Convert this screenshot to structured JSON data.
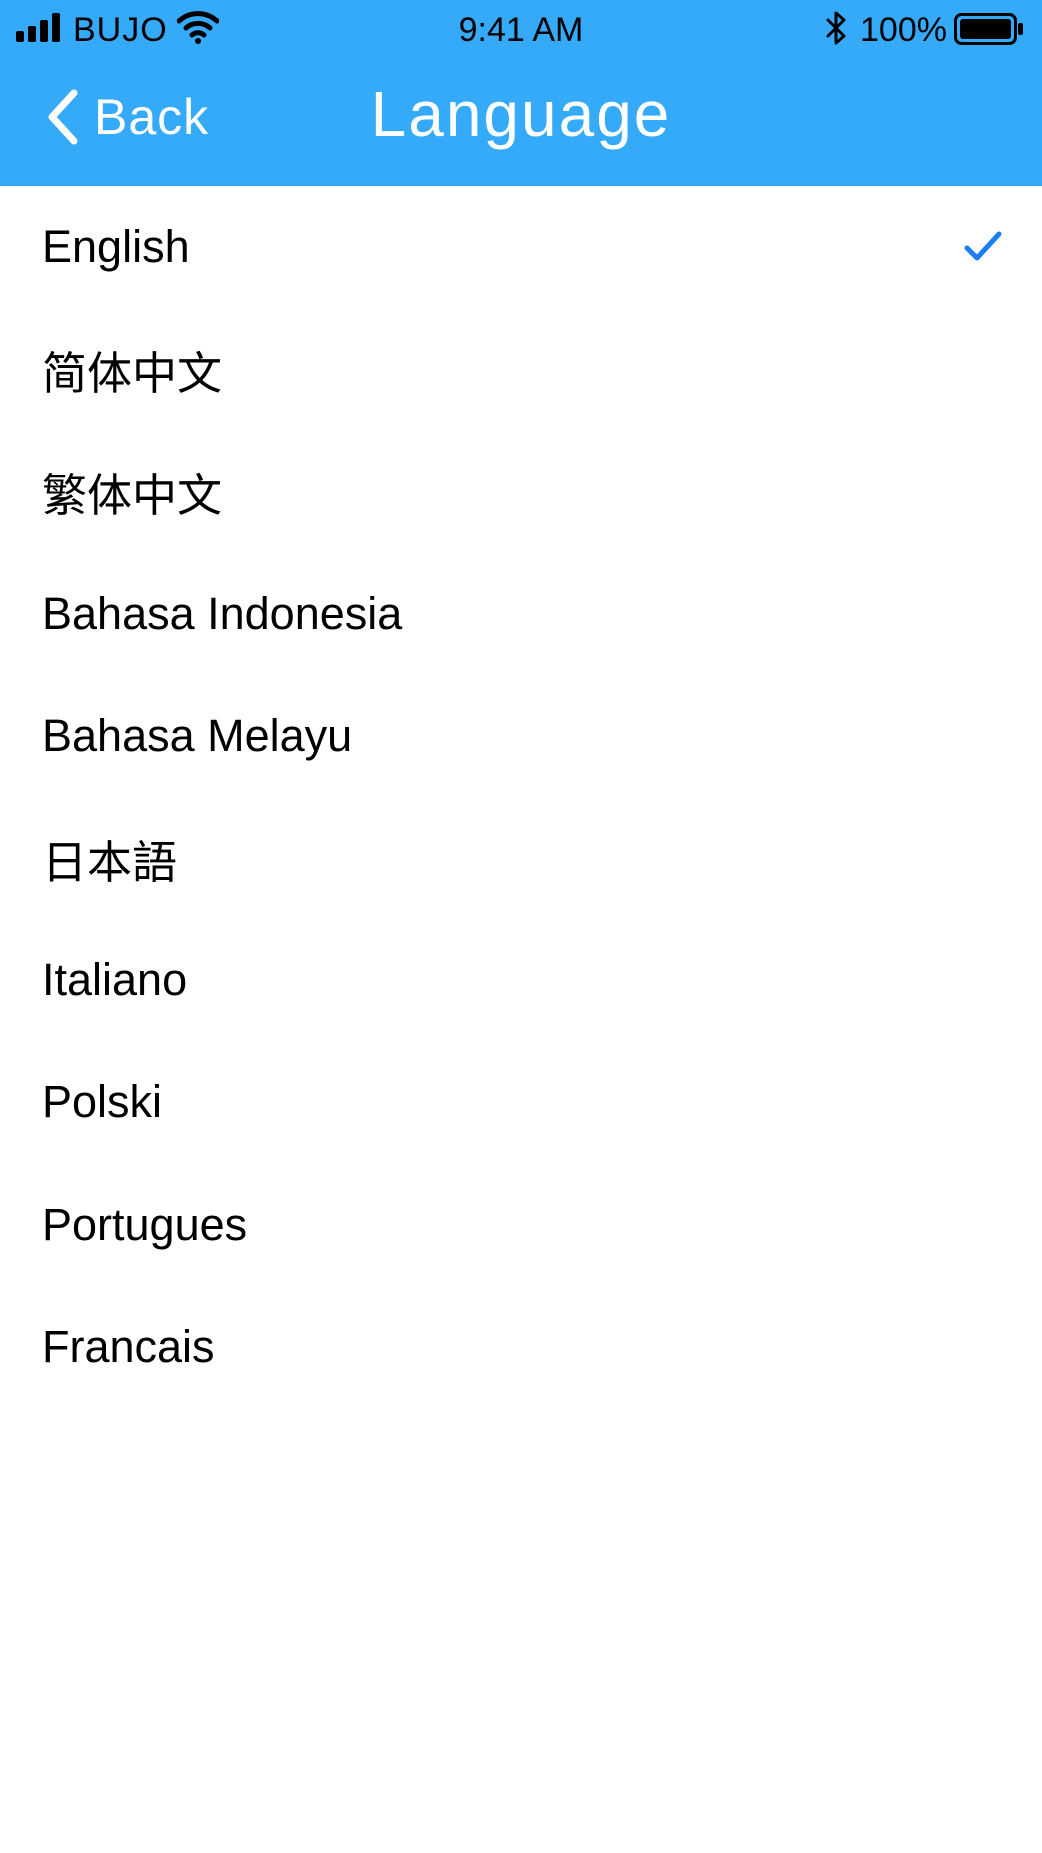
{
  "status_bar": {
    "carrier": "BUJO",
    "time": "9:41 AM",
    "battery_percent": "100%",
    "icons": [
      "signal-icon",
      "wifi-icon",
      "bluetooth-icon",
      "battery-icon"
    ]
  },
  "nav": {
    "back_label": "Back",
    "title": "Language",
    "back_icon": "chevron-left-icon"
  },
  "languages": [
    {
      "label": "English",
      "selected": true
    },
    {
      "label": "简体中文",
      "selected": false
    },
    {
      "label": "繁体中文",
      "selected": false
    },
    {
      "label": "Bahasa Indonesia",
      "selected": false
    },
    {
      "label": "Bahasa Melayu",
      "selected": false
    },
    {
      "label": "日本語",
      "selected": false
    },
    {
      "label": "Italiano",
      "selected": false
    },
    {
      "label": "Polski",
      "selected": false
    },
    {
      "label": "Portugues",
      "selected": false
    },
    {
      "label": "Francais",
      "selected": false
    }
  ],
  "selected_icon": "checkmark-icon",
  "colors": {
    "header_background": "#35aaf9",
    "header_text": "#ffffff",
    "checkmark": "#1a7ef5",
    "list_background": "#ffffff",
    "list_text": "#000000"
  }
}
